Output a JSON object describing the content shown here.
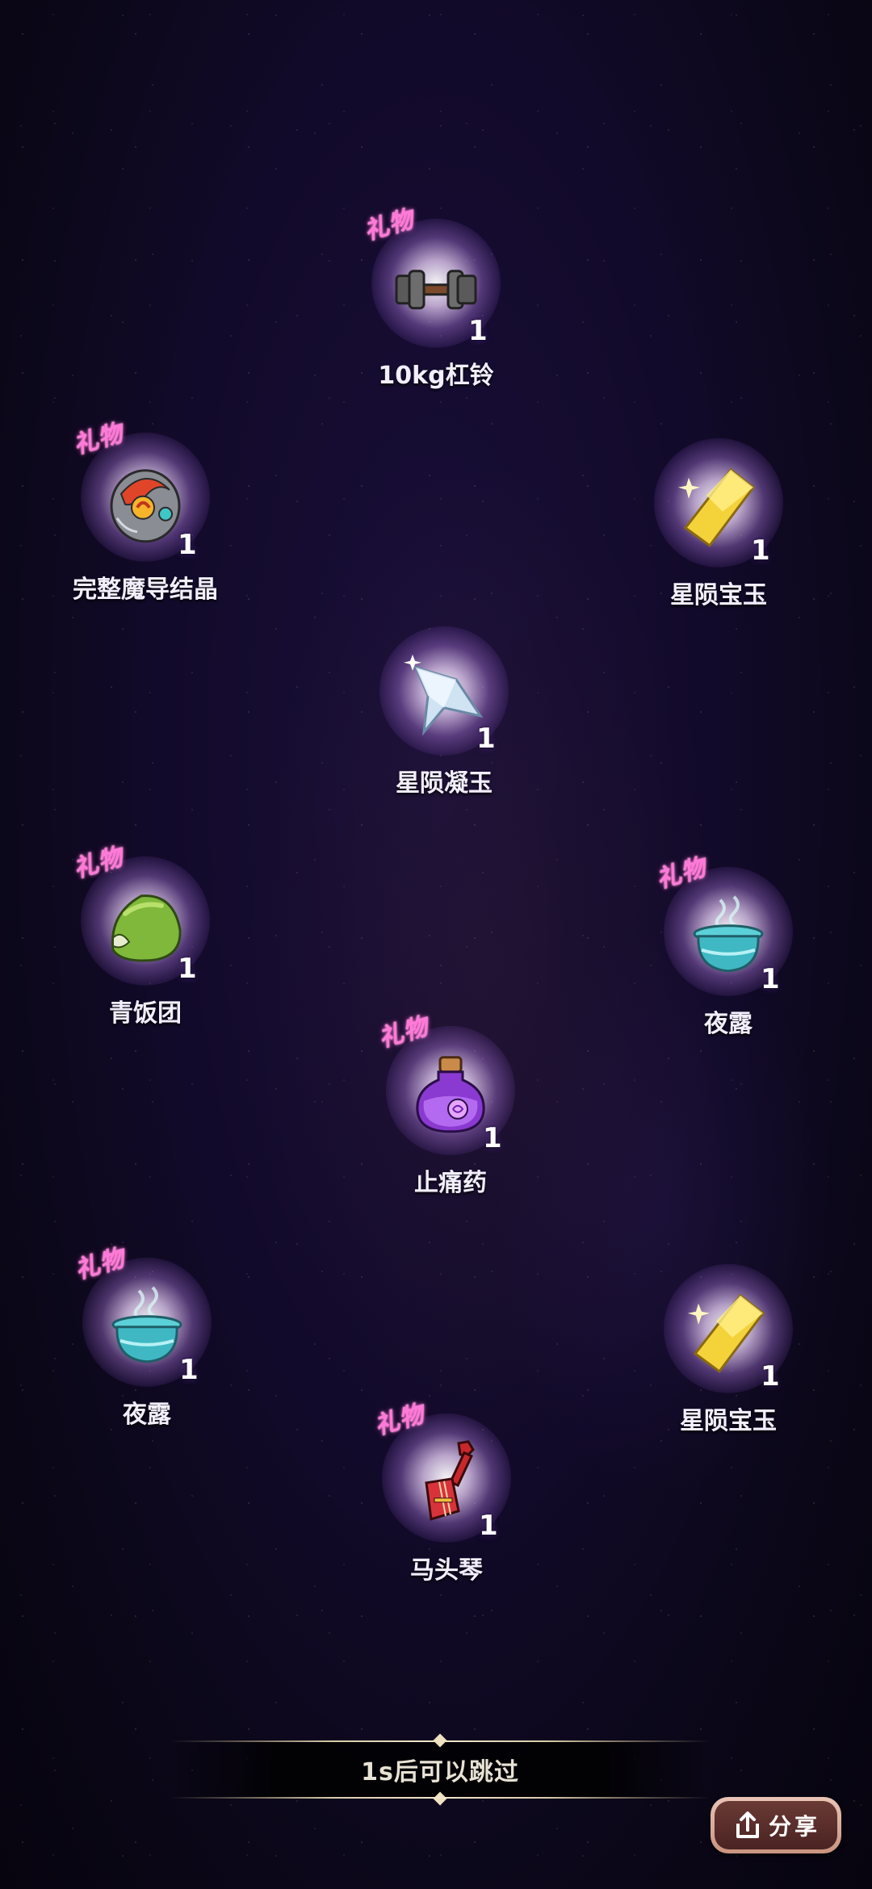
{
  "gift_tag": "礼物",
  "rewards": [
    {
      "id": "barbell",
      "name": "10kg杠铃",
      "count": "1",
      "gift": true,
      "icon": "dumbbell-icon"
    },
    {
      "id": "magic-crystal",
      "name": "完整魔导结晶",
      "count": "1",
      "gift": true,
      "icon": "magic-crystal-icon"
    },
    {
      "id": "star-gem-1",
      "name": "星陨宝玉",
      "count": "1",
      "gift": false,
      "icon": "yellow-gem-icon"
    },
    {
      "id": "star-jade",
      "name": "星陨凝玉",
      "count": "1",
      "gift": false,
      "icon": "star-jade-icon"
    },
    {
      "id": "rice-ball",
      "name": "青饭团",
      "count": "1",
      "gift": true,
      "icon": "rice-ball-icon"
    },
    {
      "id": "night-dew-1",
      "name": "夜露",
      "count": "1",
      "gift": true,
      "icon": "night-dew-jar-icon"
    },
    {
      "id": "painkiller",
      "name": "止痛药",
      "count": "1",
      "gift": true,
      "icon": "potion-bottle-icon"
    },
    {
      "id": "night-dew-2",
      "name": "夜露",
      "count": "1",
      "gift": true,
      "icon": "night-dew-jar-icon"
    },
    {
      "id": "star-gem-2",
      "name": "星陨宝玉",
      "count": "1",
      "gift": false,
      "icon": "yellow-gem-icon"
    },
    {
      "id": "horsehead-fiddle",
      "name": "马头琴",
      "count": "1",
      "gift": true,
      "icon": "horsehead-fiddle-icon"
    }
  ],
  "skip": {
    "text": "1s后可以跳过"
  },
  "share": {
    "label": "分享",
    "icon": "share-upload-icon"
  }
}
